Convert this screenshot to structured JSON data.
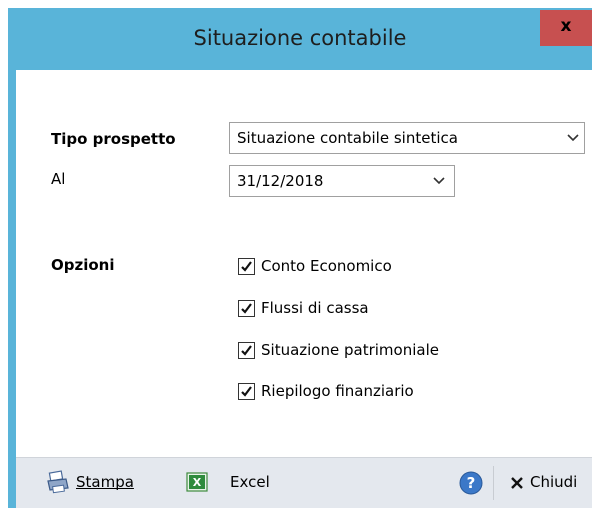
{
  "window": {
    "title": "Situazione contabile",
    "close_label": "x"
  },
  "form": {
    "tipo_prospetto_label": "Tipo prospetto",
    "tipo_prospetto_value": "Situazione contabile sintetica",
    "al_label": "Al",
    "al_value": "31/12/2018",
    "opzioni_label": "Opzioni"
  },
  "options": [
    {
      "label": "Conto Economico",
      "checked": true
    },
    {
      "label": "Flussi di cassa",
      "checked": true
    },
    {
      "label": "Situazione patrimoniale",
      "checked": true
    },
    {
      "label": "Riepilogo finanziario",
      "checked": true
    }
  ],
  "toolbar": {
    "stampa_label": "Stampa",
    "excel_label": "Excel",
    "chiudi_label": "Chiudi",
    "help_icon": "help-icon",
    "close_icon": "x-icon",
    "print_icon": "printer-icon",
    "excel_icon": "excel-icon"
  },
  "colors": {
    "title_bar": "#59b4d9",
    "close_button": "#c75050",
    "toolbar_bg": "#e4e8ee"
  }
}
